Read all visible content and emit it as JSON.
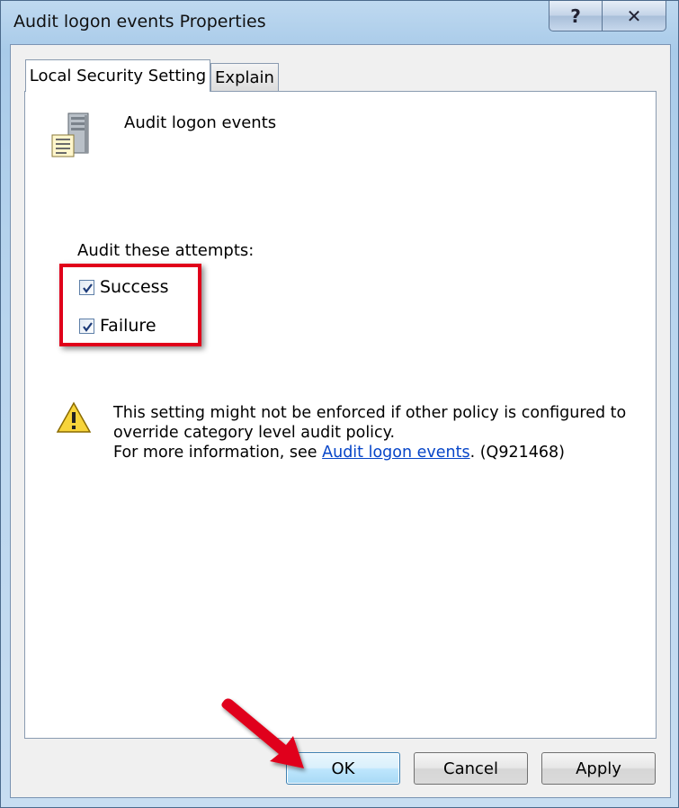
{
  "window": {
    "title": "Audit logon events Properties",
    "help_label": "?",
    "close_label": "✕"
  },
  "tabs": [
    {
      "label": "Local Security Setting",
      "active": true
    },
    {
      "label": "Explain",
      "active": false
    }
  ],
  "policy": {
    "icon": "server-policy-icon",
    "name": "Audit logon events"
  },
  "audit": {
    "label": "Audit these attempts:",
    "options": [
      {
        "label": "Success",
        "checked": true
      },
      {
        "label": "Failure",
        "checked": true
      }
    ]
  },
  "warning": {
    "icon": "warning-icon",
    "line1": "This setting might not be enforced if other policy is configured to",
    "line2": "override category level audit policy.",
    "line3_prefix": "For more information, see ",
    "link_text": "Audit logon events",
    "line3_suffix": ". (Q921468)"
  },
  "buttons": {
    "ok": "OK",
    "cancel": "Cancel",
    "apply": "Apply"
  },
  "colors": {
    "highlight": "#e0001a",
    "arrow": "#e0001a",
    "link": "#0645c8"
  }
}
